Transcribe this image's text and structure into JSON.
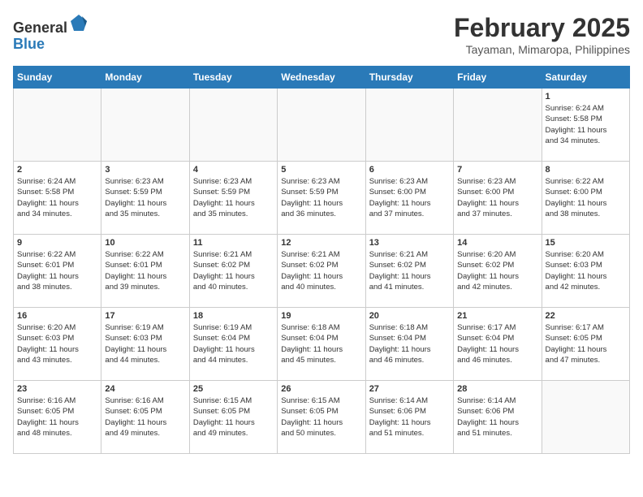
{
  "header": {
    "logo_general": "General",
    "logo_blue": "Blue",
    "title": "February 2025",
    "subtitle": "Tayaman, Mimaropa, Philippines"
  },
  "weekdays": [
    "Sunday",
    "Monday",
    "Tuesday",
    "Wednesday",
    "Thursday",
    "Friday",
    "Saturday"
  ],
  "weeks": [
    [
      {
        "day": "",
        "info": ""
      },
      {
        "day": "",
        "info": ""
      },
      {
        "day": "",
        "info": ""
      },
      {
        "day": "",
        "info": ""
      },
      {
        "day": "",
        "info": ""
      },
      {
        "day": "",
        "info": ""
      },
      {
        "day": "1",
        "info": "Sunrise: 6:24 AM\nSunset: 5:58 PM\nDaylight: 11 hours\nand 34 minutes."
      }
    ],
    [
      {
        "day": "2",
        "info": "Sunrise: 6:24 AM\nSunset: 5:58 PM\nDaylight: 11 hours\nand 34 minutes."
      },
      {
        "day": "3",
        "info": "Sunrise: 6:23 AM\nSunset: 5:59 PM\nDaylight: 11 hours\nand 35 minutes."
      },
      {
        "day": "4",
        "info": "Sunrise: 6:23 AM\nSunset: 5:59 PM\nDaylight: 11 hours\nand 35 minutes."
      },
      {
        "day": "5",
        "info": "Sunrise: 6:23 AM\nSunset: 5:59 PM\nDaylight: 11 hours\nand 36 minutes."
      },
      {
        "day": "6",
        "info": "Sunrise: 6:23 AM\nSunset: 6:00 PM\nDaylight: 11 hours\nand 37 minutes."
      },
      {
        "day": "7",
        "info": "Sunrise: 6:23 AM\nSunset: 6:00 PM\nDaylight: 11 hours\nand 37 minutes."
      },
      {
        "day": "8",
        "info": "Sunrise: 6:22 AM\nSunset: 6:00 PM\nDaylight: 11 hours\nand 38 minutes."
      }
    ],
    [
      {
        "day": "9",
        "info": "Sunrise: 6:22 AM\nSunset: 6:01 PM\nDaylight: 11 hours\nand 38 minutes."
      },
      {
        "day": "10",
        "info": "Sunrise: 6:22 AM\nSunset: 6:01 PM\nDaylight: 11 hours\nand 39 minutes."
      },
      {
        "day": "11",
        "info": "Sunrise: 6:21 AM\nSunset: 6:02 PM\nDaylight: 11 hours\nand 40 minutes."
      },
      {
        "day": "12",
        "info": "Sunrise: 6:21 AM\nSunset: 6:02 PM\nDaylight: 11 hours\nand 40 minutes."
      },
      {
        "day": "13",
        "info": "Sunrise: 6:21 AM\nSunset: 6:02 PM\nDaylight: 11 hours\nand 41 minutes."
      },
      {
        "day": "14",
        "info": "Sunrise: 6:20 AM\nSunset: 6:02 PM\nDaylight: 11 hours\nand 42 minutes."
      },
      {
        "day": "15",
        "info": "Sunrise: 6:20 AM\nSunset: 6:03 PM\nDaylight: 11 hours\nand 42 minutes."
      }
    ],
    [
      {
        "day": "16",
        "info": "Sunrise: 6:20 AM\nSunset: 6:03 PM\nDaylight: 11 hours\nand 43 minutes."
      },
      {
        "day": "17",
        "info": "Sunrise: 6:19 AM\nSunset: 6:03 PM\nDaylight: 11 hours\nand 44 minutes."
      },
      {
        "day": "18",
        "info": "Sunrise: 6:19 AM\nSunset: 6:04 PM\nDaylight: 11 hours\nand 44 minutes."
      },
      {
        "day": "19",
        "info": "Sunrise: 6:18 AM\nSunset: 6:04 PM\nDaylight: 11 hours\nand 45 minutes."
      },
      {
        "day": "20",
        "info": "Sunrise: 6:18 AM\nSunset: 6:04 PM\nDaylight: 11 hours\nand 46 minutes."
      },
      {
        "day": "21",
        "info": "Sunrise: 6:17 AM\nSunset: 6:04 PM\nDaylight: 11 hours\nand 46 minutes."
      },
      {
        "day": "22",
        "info": "Sunrise: 6:17 AM\nSunset: 6:05 PM\nDaylight: 11 hours\nand 47 minutes."
      }
    ],
    [
      {
        "day": "23",
        "info": "Sunrise: 6:16 AM\nSunset: 6:05 PM\nDaylight: 11 hours\nand 48 minutes."
      },
      {
        "day": "24",
        "info": "Sunrise: 6:16 AM\nSunset: 6:05 PM\nDaylight: 11 hours\nand 49 minutes."
      },
      {
        "day": "25",
        "info": "Sunrise: 6:15 AM\nSunset: 6:05 PM\nDaylight: 11 hours\nand 49 minutes."
      },
      {
        "day": "26",
        "info": "Sunrise: 6:15 AM\nSunset: 6:05 PM\nDaylight: 11 hours\nand 50 minutes."
      },
      {
        "day": "27",
        "info": "Sunrise: 6:14 AM\nSunset: 6:06 PM\nDaylight: 11 hours\nand 51 minutes."
      },
      {
        "day": "28",
        "info": "Sunrise: 6:14 AM\nSunset: 6:06 PM\nDaylight: 11 hours\nand 51 minutes."
      },
      {
        "day": "",
        "info": ""
      }
    ]
  ]
}
